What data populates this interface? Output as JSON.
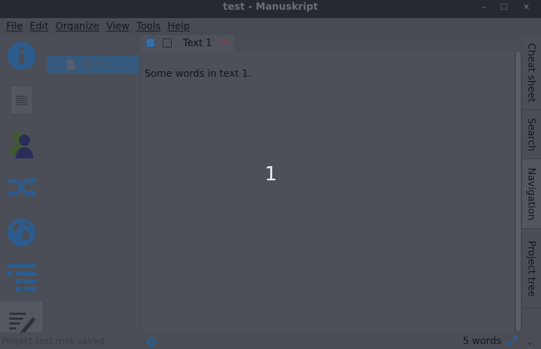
{
  "window": {
    "title": "test - Manuskript",
    "minimize": "–",
    "maximize": "☐",
    "close": "✕"
  },
  "menubar": {
    "items": [
      "File",
      "Edit",
      "Organize",
      "View",
      "Tools",
      "Help"
    ]
  },
  "sidebar": {
    "icons": [
      "info-icon",
      "summary-icon",
      "characters-icon",
      "plot-icon",
      "world-icon",
      "outline-icon",
      "editor-icon"
    ]
  },
  "tree": {
    "items": [
      {
        "label": "Text 1"
      }
    ]
  },
  "tabs": [
    {
      "label": "Text 1",
      "close": "✕"
    }
  ],
  "editor": {
    "text": "Some words in text 1.",
    "page_number": "1"
  },
  "right_tabs": {
    "cheat_sheet": "Cheat sheet",
    "search": "Search",
    "navigation": "Navigation",
    "project_tree": "Project tree"
  },
  "status": {
    "message": "Project test.msk saved.",
    "word_count": "5 words"
  },
  "colors": {
    "accent": "#3b6ea3",
    "tab_close": "#a1382f",
    "background": "#4a4d55"
  }
}
